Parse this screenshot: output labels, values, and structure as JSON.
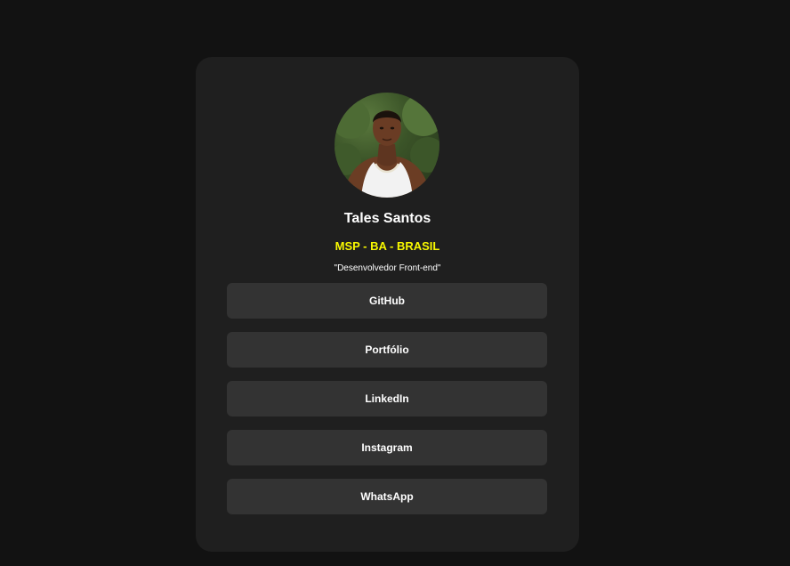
{
  "profile": {
    "name": "Tales Santos",
    "location": "MSP - BA - BRASIL",
    "role": "\"Desenvolvedor Front-end\"",
    "avatar_icon": "profile-photo"
  },
  "links": [
    {
      "label": "GitHub"
    },
    {
      "label": "Portfólio"
    },
    {
      "label": "LinkedIn"
    },
    {
      "label": "Instagram"
    },
    {
      "label": "WhatsApp"
    }
  ],
  "colors": {
    "page_background": "#121212",
    "card_background": "#1f1f1f",
    "button_background": "#333333",
    "accent_yellow": "#f7f700",
    "text": "#ffffff"
  }
}
